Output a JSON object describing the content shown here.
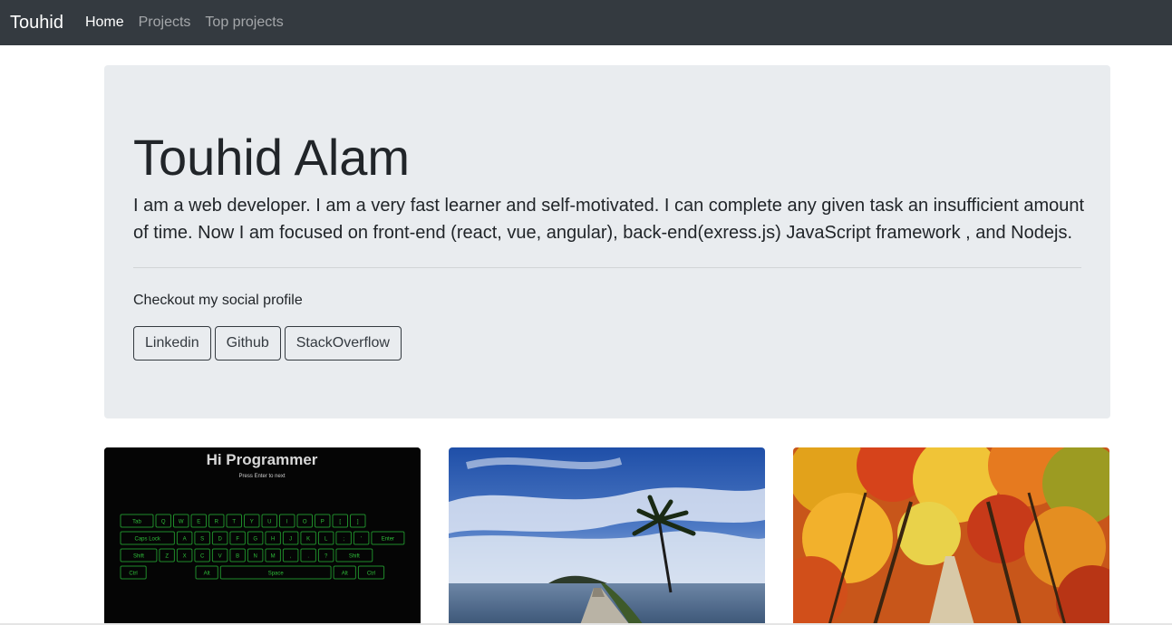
{
  "navbar": {
    "brand": "Touhid",
    "links": [
      {
        "label": "Home",
        "active": true
      },
      {
        "label": "Projects",
        "active": false
      },
      {
        "label": "Top projects",
        "active": false
      }
    ]
  },
  "hero": {
    "title": "Touhid Alam",
    "lead": "I am a web developer. I am a very fast learner and self-motivated. I can complete any given task an insufficient amount of time. Now I am focused on front-end (react, vue, angular), back-end(exress.js) JavaScript framework , and Nodejs.",
    "social_text": "Checkout my social profile",
    "buttons": [
      "Linkedin",
      "Github",
      "StackOverflow"
    ]
  },
  "cards": [
    {
      "image": "keyboard-typing-game-screenshot",
      "heading": "Hi Programmer",
      "subheading": "Press Enter to next",
      "keyboard_rows": [
        [
          "Tab",
          "Q",
          "W",
          "E",
          "R",
          "T",
          "Y",
          "U",
          "I",
          "O",
          "P",
          "[",
          "]"
        ],
        [
          "Caps Lock",
          "A",
          "S",
          "D",
          "F",
          "G",
          "H",
          "J",
          "K",
          "L",
          ";",
          "'",
          "Enter"
        ],
        [
          "Shift",
          "Z",
          "X",
          "C",
          "V",
          "B",
          "N",
          "M",
          ",",
          ".",
          "?",
          "Shift"
        ],
        [
          "Ctrl",
          "Alt",
          "Space",
          "Alt",
          "Ctrl"
        ]
      ]
    },
    {
      "image": "palm-tree-lake-blue-sky-photo"
    },
    {
      "image": "autumn-tree-lined-road-photo"
    }
  ],
  "colors": {
    "navbar_bg": "#343a40",
    "jumbotron_bg": "#e9ecef",
    "key_border": "#1f8a2a",
    "key_text": "#2fbf3a",
    "heading_text": "#d8d8d8"
  }
}
